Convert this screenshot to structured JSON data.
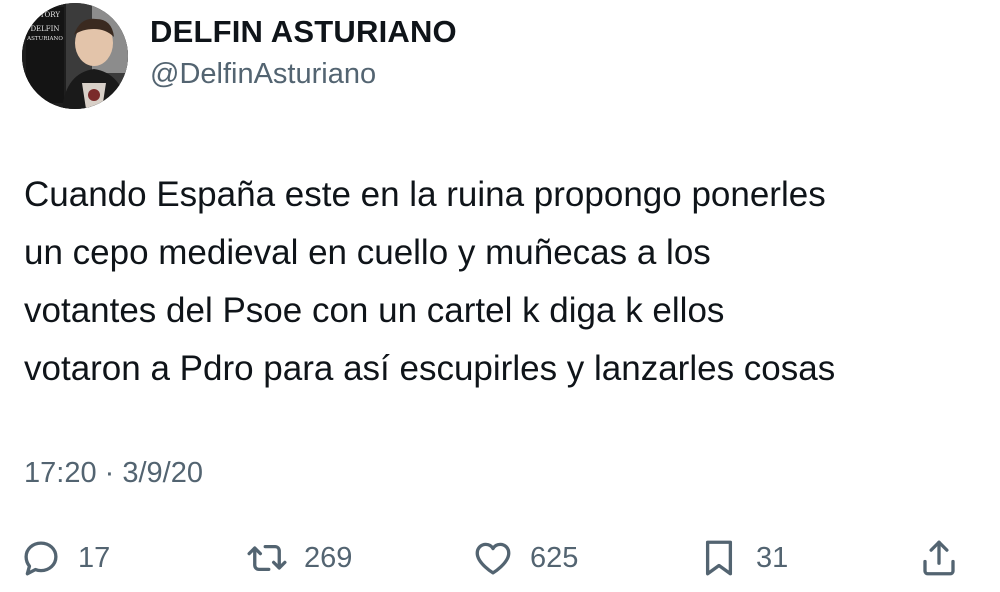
{
  "author": {
    "display_name": "DELFIN ASTURIANO",
    "handle": "@DelfinAsturiano",
    "avatar_icon": "profile-photo",
    "avatar_text_lines": [
      "ASTORY",
      "DELFIN",
      "ASTURIANO"
    ]
  },
  "tweet": {
    "lines": [
      "Cuando España este en la ruina propongo ponerles",
      "un cepo medieval en cuello y muñecas a los",
      "votantes del Psoe con un cartel k diga k ellos",
      "votaron a Pdro para así escupirles y lanzarles cosas"
    ],
    "timestamp": "17:20 · 3/9/20"
  },
  "actions": {
    "reply": {
      "icon": "reply-icon",
      "count": "17"
    },
    "retweet": {
      "icon": "retweet-icon",
      "count": "269"
    },
    "like": {
      "icon": "heart-icon",
      "count": "625"
    },
    "bookmark": {
      "icon": "bookmark-icon",
      "count": "31"
    },
    "share": {
      "icon": "share-icon"
    }
  },
  "colors": {
    "text_primary": "#0f1419",
    "text_secondary": "#536471"
  }
}
